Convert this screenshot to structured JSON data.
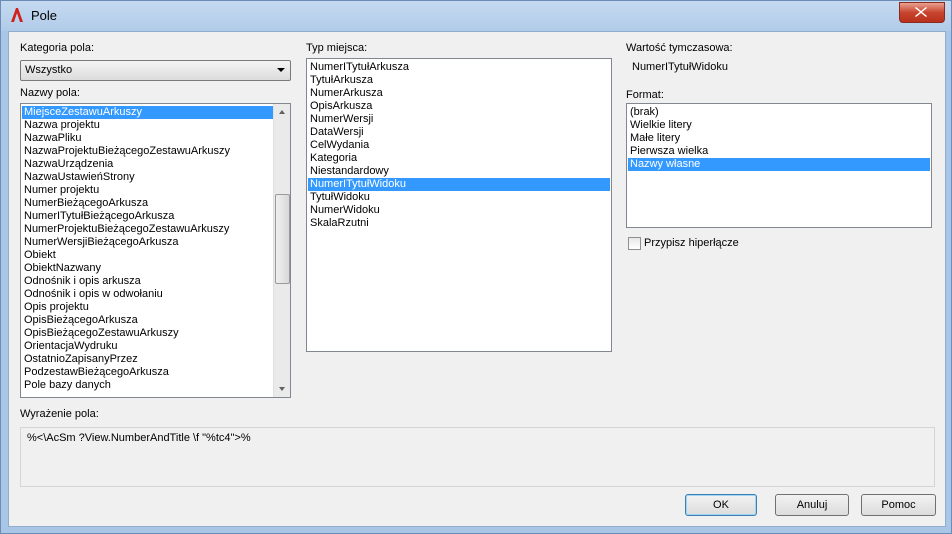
{
  "window": {
    "title": "Pole",
    "app_icon": "autocad-a-icon",
    "close_icon": "close-icon"
  },
  "category": {
    "label": "Kategoria pola:",
    "selected": "Wszystko"
  },
  "field_names": {
    "label": "Nazwy pola:",
    "items": [
      "MiejsceZestawuArkuszy",
      "Nazwa projektu",
      "NazwaPliku",
      "NazwaProjektuBieżącegoZestawuArkuszy",
      "NazwaUrządzenia",
      "NazwaUstawieńStrony",
      "Numer projektu",
      "NumerBieżącegoArkusza",
      "NumerITytułBieżącegoArkusza",
      "NumerProjektuBieżącegoZestawuArkuszy",
      "NumerWersjiBieżącegoArkusza",
      "Obiekt",
      "ObiektNazwany",
      "Odnośnik i opis arkusza",
      "Odnośnik i opis w odwołaniu",
      "Opis projektu",
      "OpisBieżącegoArkusza",
      "OpisBieżącegoZestawuArkuszy",
      "OrientacjaWydruku",
      "OstatnioZapisanyPrzez",
      "PodzestawBieżącegoArkusza",
      "Pole bazy danych"
    ],
    "selected_index": 0
  },
  "place_type": {
    "label": "Typ miejsca:",
    "items": [
      "NumerITytułArkusza",
      "TytułArkusza",
      "NumerArkusza",
      "OpisArkusza",
      "NumerWersji",
      "DataWersji",
      "CelWydania",
      "Kategoria",
      "Niestandardowy",
      "NumerITytułWidoku",
      "TytułWidoku",
      "NumerWidoku",
      "SkalaRzutni"
    ],
    "selected_index": 9
  },
  "temp_value": {
    "label": "Wartość tymczasowa:",
    "value": "NumerITytułWidoku"
  },
  "format": {
    "label": "Format:",
    "items": [
      "(brak)",
      "Wielkie litery",
      "Małe litery",
      "Pierwsza wielka",
      "Nazwy własne"
    ],
    "selected_index": 4
  },
  "hyperlink": {
    "label": "Przypisz hiperłącze",
    "checked": false
  },
  "expression": {
    "label": "Wyrażenie pola:",
    "value": "%<\\AcSm ?View.NumberAndTitle \\f \"%tc4\">%"
  },
  "buttons": {
    "ok": "OK",
    "cancel": "Anuluj",
    "help": "Pomoc"
  },
  "colors": {
    "selection": "#3399ff",
    "close_button": "#c7442f"
  }
}
